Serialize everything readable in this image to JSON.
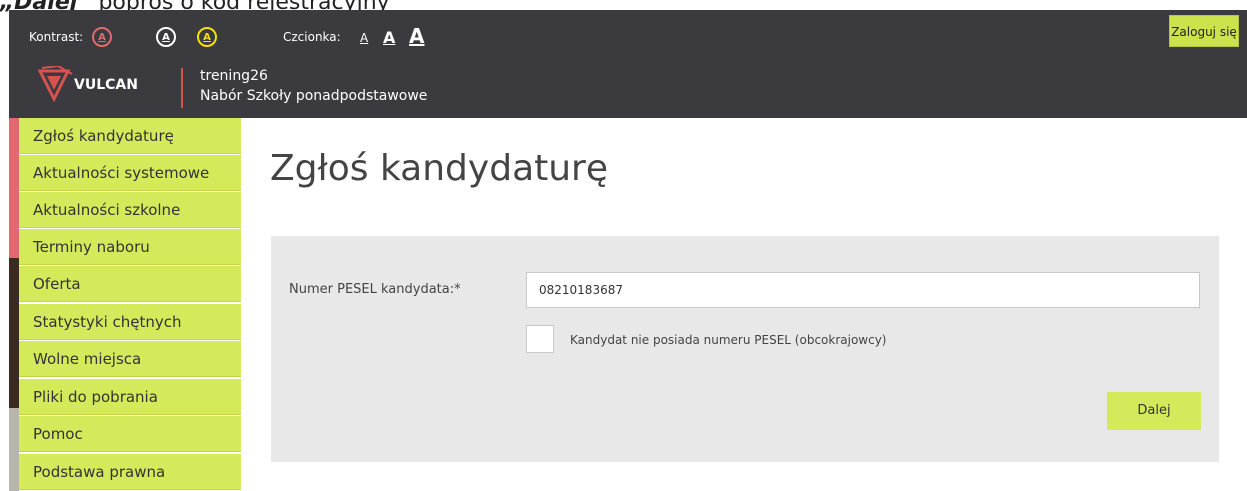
{
  "caption": {
    "bold": "„Dalej”",
    "rest": " poproś o kod rejestracyjny"
  },
  "header": {
    "kontrast_label": "Kontrast:",
    "contrast_buttons": [
      {
        "label": "A",
        "color": "#e06a6f"
      },
      {
        "label": "A",
        "color": "#ffffff"
      },
      {
        "label": "A",
        "color": "#f2e200"
      }
    ],
    "czcionka_label": "Czcionka:",
    "font_sizes": [
      "A",
      "A",
      "A"
    ],
    "login_label": "Zaloguj się"
  },
  "brand": {
    "logo_text": "VULCAN",
    "line1": "trening26",
    "line2": "Nabór Szkoły ponadpodstawowe"
  },
  "sidebar": {
    "items": [
      {
        "label": "Zgłoś kandydaturę"
      },
      {
        "label": "Aktualności systemowe"
      },
      {
        "label": "Aktualności szkolne"
      },
      {
        "label": "Terminy naboru"
      },
      {
        "label": "Oferta"
      },
      {
        "label": "Statystyki chętnych"
      },
      {
        "label": "Wolne miejsca"
      },
      {
        "label": "Pliki do pobrania"
      },
      {
        "label": "Pomoc"
      },
      {
        "label": "Podstawa prawna"
      }
    ]
  },
  "main": {
    "title": "Zgłoś kandydaturę",
    "form": {
      "pesel_label": "Numer PESEL kandydata:*",
      "pesel_value": "08210183687",
      "no_pesel_label": "Kandydat nie posiada numeru PESEL (obcokrajowcy)",
      "no_pesel_checked": false,
      "next_button": "Dalej"
    }
  },
  "colors": {
    "accent": "#d5ea5b",
    "header_bg": "#3a3a3f",
    "brand_red": "#d8534f"
  }
}
